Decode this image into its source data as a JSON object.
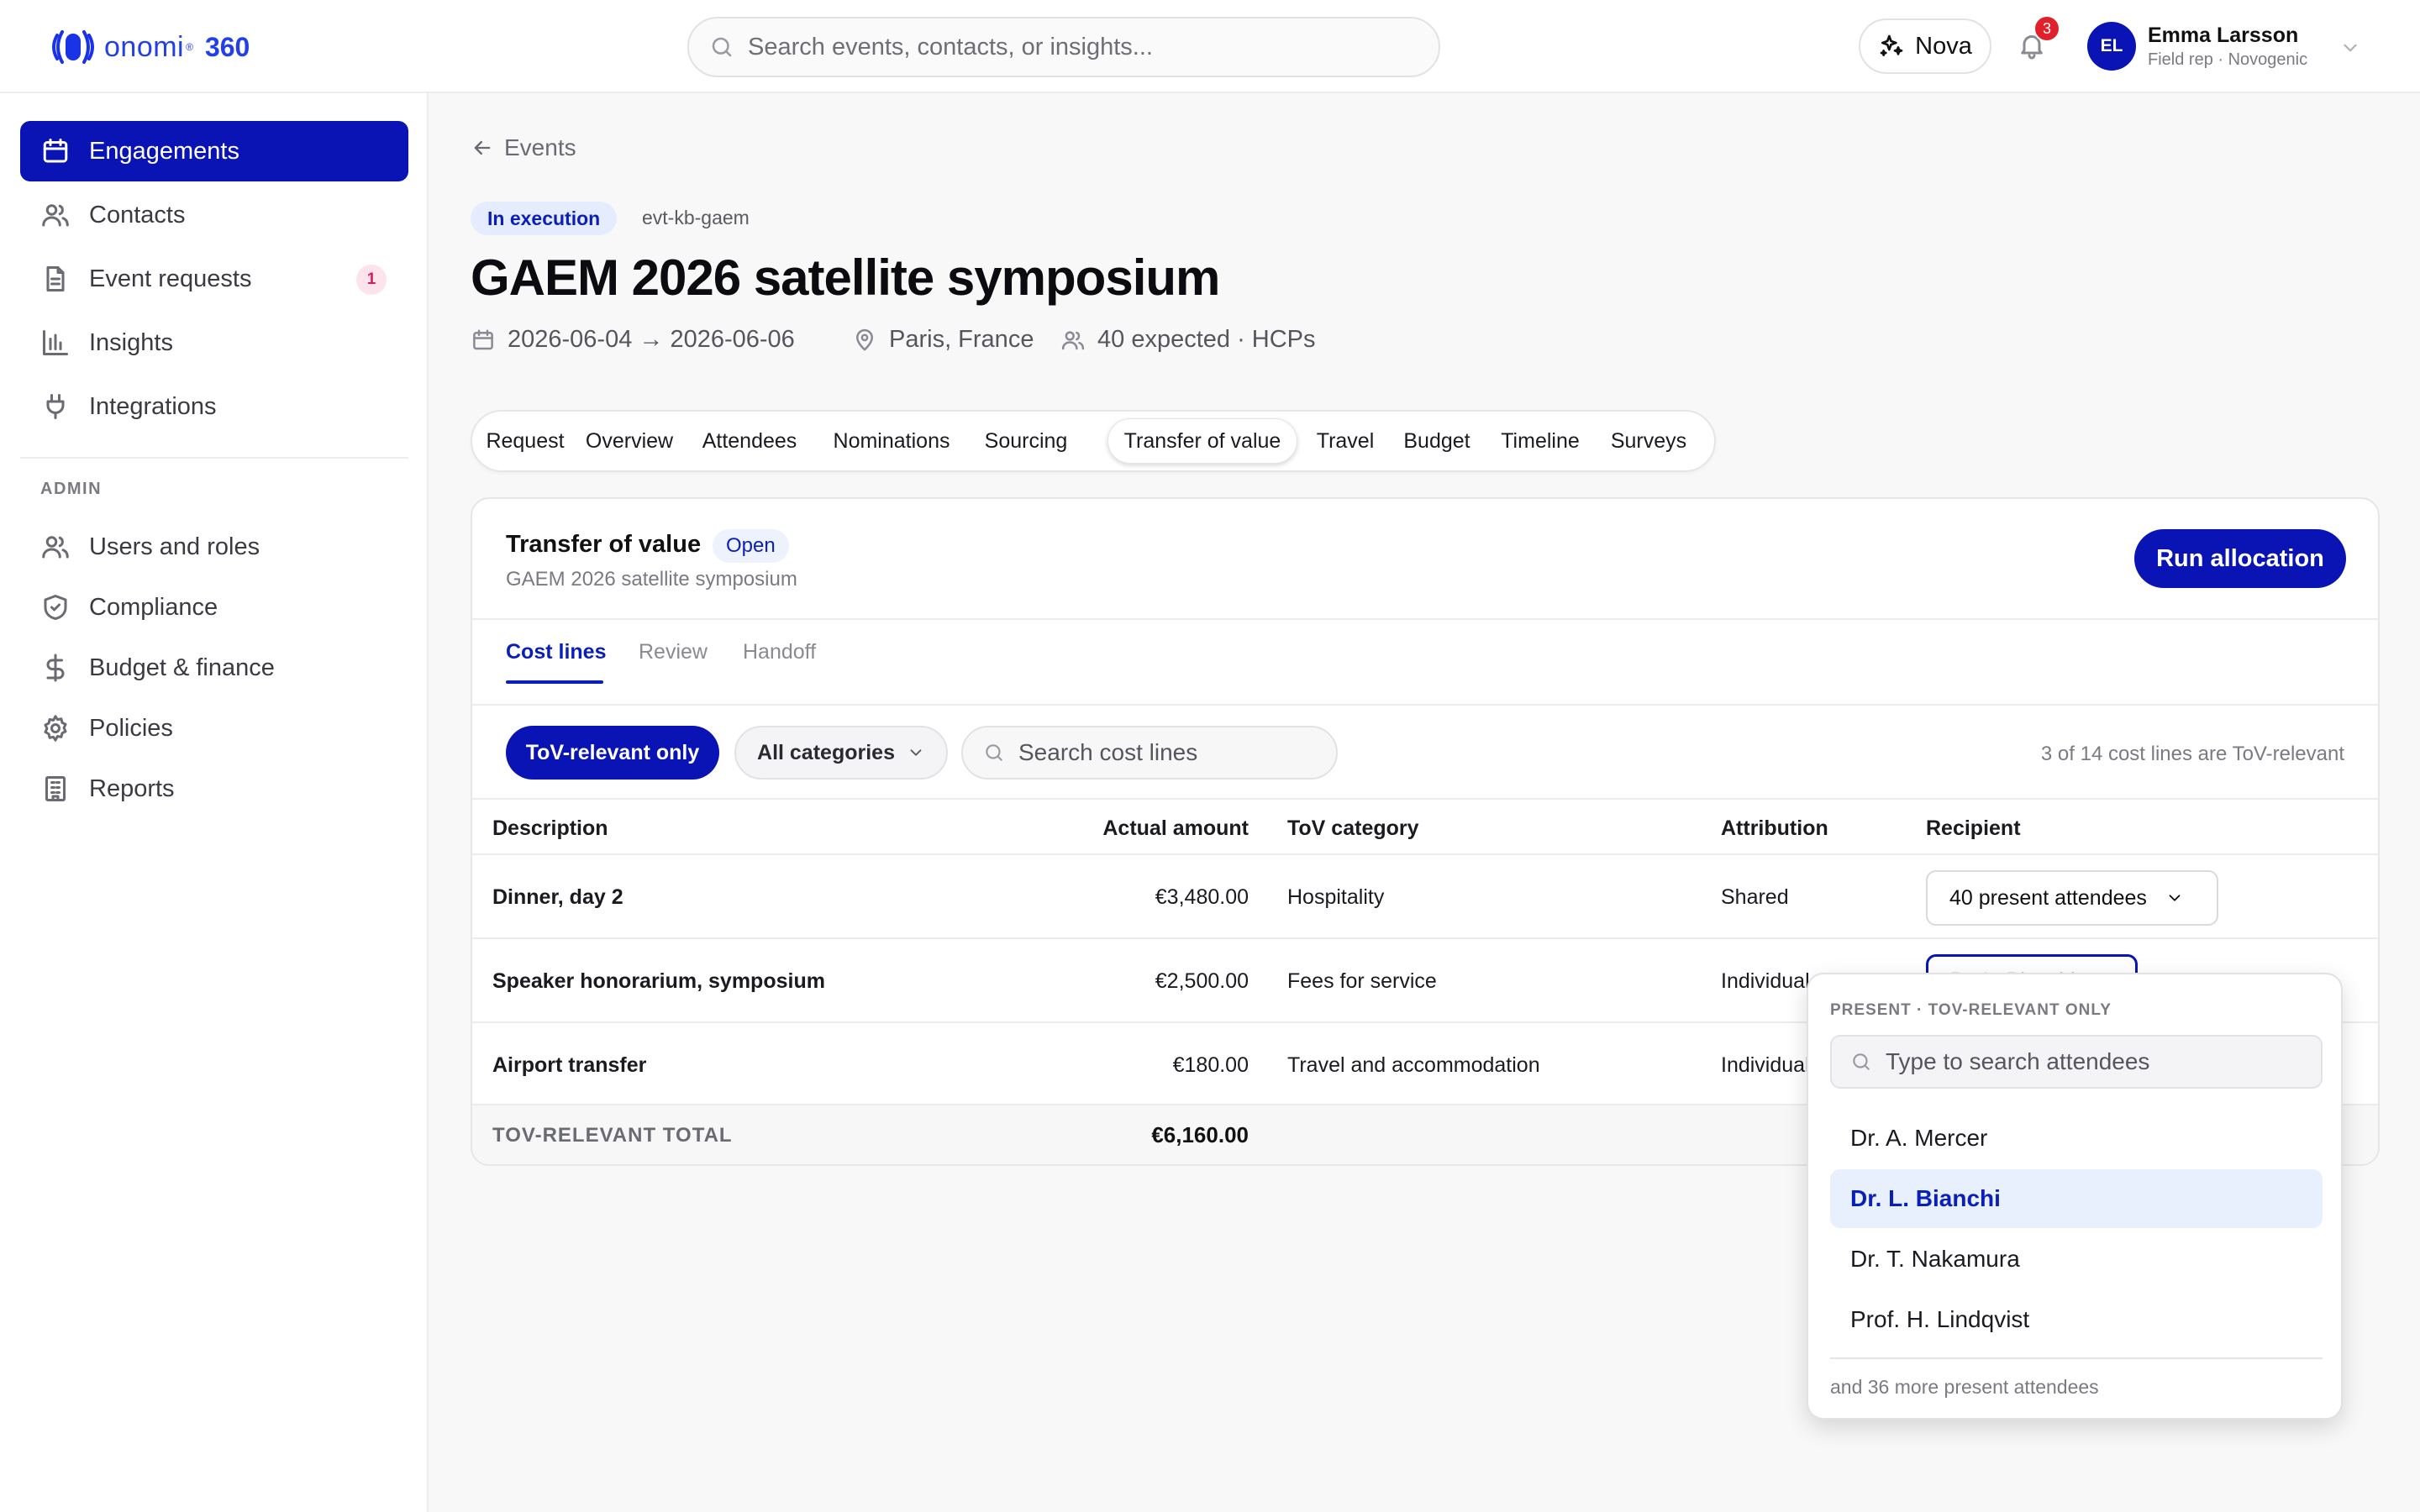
{
  "brand": {
    "name": "onomi",
    "suffix": "360",
    "accent": "#0a14b4"
  },
  "header": {
    "search_placeholder": "Search events, contacts, or insights...",
    "assistant_label": "Nova",
    "notifications_count": "3",
    "user": {
      "initials": "EL",
      "name": "Emma Larsson",
      "role": "Field rep · Novogenic"
    }
  },
  "sidebar": {
    "items": [
      {
        "label": "Engagements",
        "icon": "calendar-icon",
        "active": true
      },
      {
        "label": "Contacts",
        "icon": "users-icon"
      },
      {
        "label": "Event requests",
        "icon": "document-icon",
        "badge": "1"
      },
      {
        "label": "Insights",
        "icon": "bar-chart-icon"
      },
      {
        "label": "Integrations",
        "icon": "plug-icon"
      }
    ],
    "admin_heading": "ADMIN",
    "admin_items": [
      {
        "label": "Users and roles",
        "icon": "users-icon"
      },
      {
        "label": "Compliance",
        "icon": "shield-icon"
      },
      {
        "label": "Budget & finance",
        "icon": "dollar-icon"
      },
      {
        "label": "Policies",
        "icon": "gear-icon"
      },
      {
        "label": "Reports",
        "icon": "building-icon"
      }
    ]
  },
  "event": {
    "back_label": "Events",
    "status": "In execution",
    "id": "evt-kb-gaem",
    "title": "GAEM 2026 satellite symposium",
    "dates": "2026-06-04 → 2026-06-06",
    "location": "Paris, France",
    "expected": "40 expected · HCPs"
  },
  "tabs": [
    "Request",
    "Overview",
    "Attendees",
    "Nominations",
    "Sourcing",
    "Transfer of value",
    "Travel",
    "Budget",
    "Timeline",
    "Surveys"
  ],
  "active_tab": "Transfer of value",
  "tov": {
    "title": "Transfer of value",
    "status": "Open",
    "subtitle": "GAEM 2026 satellite symposium",
    "run_button": "Run allocation",
    "subtabs": [
      "Cost lines",
      "Review",
      "Handoff"
    ],
    "filter_primary": "ToV-relevant only",
    "filter_category": "All categories",
    "search_placeholder": "Search cost lines",
    "count_note": "3 of 14 cost lines are ToV-relevant",
    "columns": [
      "Description",
      "Actual amount",
      "ToV category",
      "Attribution",
      "Recipient"
    ],
    "rows": [
      {
        "description": "Dinner, day 2",
        "amount": "€3,480.00",
        "category": "Hospitality",
        "attribution": "Shared",
        "recipient": "40 present attendees"
      },
      {
        "description": "Speaker honorarium, symposium",
        "amount": "€2,500.00",
        "category": "Fees for service",
        "attribution": "Individual",
        "recipient": "Dr. L. Bianchi"
      },
      {
        "description": "Airport transfer",
        "amount": "€180.00",
        "category": "Travel and accommodation",
        "attribution": "Individual",
        "recipient": ""
      }
    ],
    "total_label": "TOV-RELEVANT TOTAL",
    "total_value": "€6,160.00"
  },
  "recipient_dropdown": {
    "heading": "PRESENT · TOV-RELEVANT ONLY",
    "search_placeholder": "Type to search attendees",
    "options": [
      "Dr. A. Mercer",
      "Dr. L. Bianchi",
      "Dr. T. Nakamura",
      "Prof. H. Lindqvist"
    ],
    "highlighted": "Dr. L. Bianchi",
    "footer": "and 36 more present attendees"
  }
}
